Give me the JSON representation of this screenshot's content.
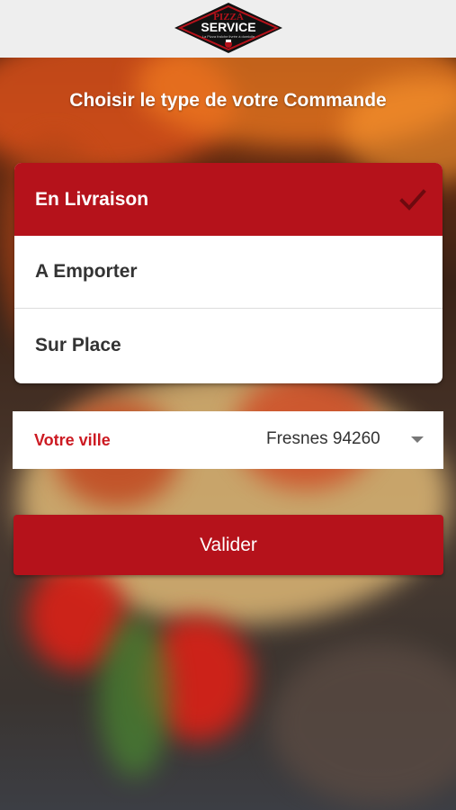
{
  "brand": {
    "logo_top": "PIZZA",
    "logo_main": "SERVICE",
    "logo_tagline": "La Pizza fraîche livrée à domicile"
  },
  "page": {
    "title": "Choisir le type de votre Commande"
  },
  "order_types": [
    {
      "label": "En Livraison",
      "selected": true
    },
    {
      "label": "A Emporter",
      "selected": false
    },
    {
      "label": "Sur Place",
      "selected": false
    }
  ],
  "city": {
    "label": "Votre ville",
    "value": "Fresnes 94260"
  },
  "actions": {
    "validate_label": "Valider"
  },
  "colors": {
    "accent": "#b5121b",
    "label_red": "#cc1a22",
    "topbar": "#eeeeee"
  },
  "icons": {
    "selected": "check-icon",
    "dropdown": "caret-down-icon"
  }
}
